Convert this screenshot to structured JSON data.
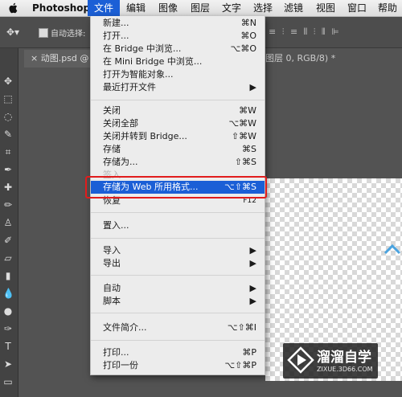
{
  "menubar": {
    "app_name": "Photoshop",
    "items": [
      "文件",
      "编辑",
      "图像",
      "图层",
      "文字",
      "选择",
      "滤镜",
      "视图",
      "窗口",
      "帮助"
    ]
  },
  "options_bar": {
    "auto_select_label": "自动选择:"
  },
  "document": {
    "tab_title": "动图.psd @ 10",
    "tab_info": "图层 0, RGB/8) *"
  },
  "file_menu": {
    "items": [
      {
        "label": "新建...",
        "shortcut": "⌘N"
      },
      {
        "label": "打开...",
        "shortcut": "⌘O"
      },
      {
        "label": "在 Bridge 中浏览...",
        "shortcut": "⌥⌘O"
      },
      {
        "label": "在 Mini Bridge 中浏览...",
        "shortcut": ""
      },
      {
        "label": "打开为智能对象...",
        "shortcut": ""
      },
      {
        "label": "最近打开文件",
        "shortcut": "▶"
      },
      {
        "label": "关闭",
        "shortcut": "⌘W"
      },
      {
        "label": "关闭全部",
        "shortcut": "⌥⌘W"
      },
      {
        "label": "关闭并转到 Bridge...",
        "shortcut": "⇧⌘W"
      },
      {
        "label": "存储",
        "shortcut": "⌘S"
      },
      {
        "label": "存储为...",
        "shortcut": "⇧⌘S"
      },
      {
        "label": "签入...",
        "shortcut": ""
      },
      {
        "label": "存储为 Web 所用格式...",
        "shortcut": "⌥⇧⌘S"
      },
      {
        "label": "恢复",
        "shortcut": "F12"
      },
      {
        "label": "置入...",
        "shortcut": ""
      },
      {
        "label": "导入",
        "shortcut": "▶"
      },
      {
        "label": "导出",
        "shortcut": "▶"
      },
      {
        "label": "自动",
        "shortcut": "▶"
      },
      {
        "label": "脚本",
        "shortcut": "▶"
      },
      {
        "label": "文件简介...",
        "shortcut": "⌥⇧⌘I"
      },
      {
        "label": "打印...",
        "shortcut": "⌘P"
      },
      {
        "label": "打印一份",
        "shortcut": "⌥⇧⌘P"
      }
    ]
  },
  "watermark": {
    "title": "溜溜自学",
    "url": "ZIXUE.3D66.COM"
  },
  "colors": {
    "highlight": "#1b5fd6",
    "annotation": "#e11c1c"
  }
}
